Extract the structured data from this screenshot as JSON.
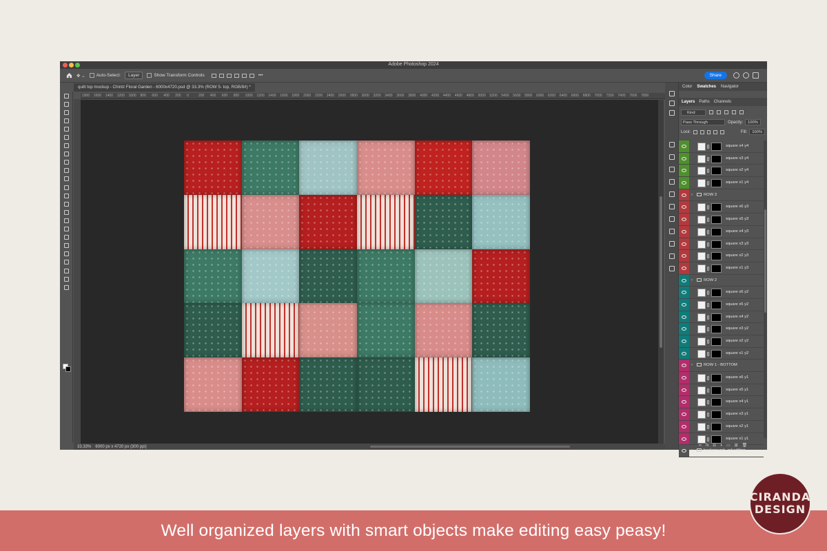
{
  "window": {
    "app_title": "Adobe Photoshop 2024",
    "document_tab": "quilt top mockup - Chintz Floral Garden - 6000x4720.psd @ 33.3% (ROW  5- top, RGB/8#) *"
  },
  "options_bar": {
    "auto_select_label": "Auto-Select:",
    "auto_select_value": "Layer",
    "show_transform_label": "Show Transform Controls",
    "more_label": "•••",
    "share_label": "Share"
  },
  "ruler_top": [
    "1900",
    "1600",
    "1400",
    "1200",
    "1000",
    "800",
    "600",
    "400",
    "200",
    "0",
    "200",
    "400",
    "600",
    "800",
    "1000",
    "1200",
    "1400",
    "1600",
    "1800",
    "2000",
    "2200",
    "2400",
    "2600",
    "2800",
    "3000",
    "3200",
    "3400",
    "3600",
    "3800",
    "4000",
    "4200",
    "4400",
    "4600",
    "4800",
    "5000",
    "5200",
    "5400",
    "5600",
    "5800",
    "6000",
    "6200",
    "6400",
    "6600",
    "6800",
    "7000",
    "7200",
    "7400",
    "7600",
    "7800"
  ],
  "status_bar": {
    "zoom": "33.33%",
    "doc_info": "6000 px x 4720 px (300 ppi)"
  },
  "quilt": {
    "rows": [
      [
        "#b8201f",
        "#3d7a65",
        "#9fc4c3",
        "#d98d8a",
        "#c0221f",
        "#d2868a"
      ],
      [
        "#f0e4dc",
        "#d88e8c",
        "#b51f1f",
        "#efe2da",
        "#2e5d4e",
        "#95c0c0"
      ],
      [
        "#3d7a65",
        "#a3c8c8",
        "#2e5d4e",
        "#3d7a65",
        "#9cc3bb",
        "#b51f1f"
      ],
      [
        "#2e5d4e",
        "#efe2da",
        "#d8908a",
        "#3d7a65",
        "#d88c8a",
        "#2e5d4e"
      ],
      [
        "#d98d8a",
        "#b51f1f",
        "#2e5d4e",
        "#2e5d4e",
        "#efe2da",
        "#8ebcbc"
      ]
    ]
  },
  "panel": {
    "top_tabs": [
      "Color",
      "Swatches",
      "Navigator"
    ],
    "layer_tabs": [
      "Layers",
      "Paths",
      "Channels"
    ],
    "kind_label": "Kind",
    "blend_mode": "Pass Through",
    "opacity_label": "Opacity:",
    "opacity_value": "100%",
    "lock_label": "Lock:",
    "fill_label": "Fill:",
    "fill_value": "100%",
    "layers": [
      {
        "type": "layer",
        "name": "square x4 y4",
        "color": "#4f8f2e"
      },
      {
        "type": "layer",
        "name": "square x3 y4",
        "color": "#4f8f2e"
      },
      {
        "type": "layer",
        "name": "square x2 y4",
        "color": "#4f8f2e"
      },
      {
        "type": "layer",
        "name": "square x1 y4",
        "color": "#4f8f2e"
      },
      {
        "type": "group",
        "name": "ROW 3",
        "color": "#b3393d"
      },
      {
        "type": "layer",
        "name": "square x6 y3",
        "color": "#b3393d"
      },
      {
        "type": "layer",
        "name": "square x5 y3",
        "color": "#b3393d"
      },
      {
        "type": "layer",
        "name": "square x4 y3",
        "color": "#b3393d"
      },
      {
        "type": "layer",
        "name": "square x3 y3",
        "color": "#b3393d"
      },
      {
        "type": "layer",
        "name": "square x2 y3",
        "color": "#b3393d"
      },
      {
        "type": "layer",
        "name": "square x1 y3",
        "color": "#b3393d"
      },
      {
        "type": "group",
        "name": "ROW 2",
        "color": "#0f7c7a"
      },
      {
        "type": "layer",
        "name": "square x6 y2",
        "color": "#0f7c7a"
      },
      {
        "type": "layer",
        "name": "square x5 y2",
        "color": "#0f7c7a"
      },
      {
        "type": "layer",
        "name": "square x4 y2",
        "color": "#0f7c7a"
      },
      {
        "type": "layer",
        "name": "square x3 y2",
        "color": "#0f7c7a"
      },
      {
        "type": "layer",
        "name": "square x2 y2",
        "color": "#0f7c7a"
      },
      {
        "type": "layer",
        "name": "square x1 y2",
        "color": "#0f7c7a"
      },
      {
        "type": "group",
        "name": "ROW 1 - BOTTOM",
        "color": "#b32d6b"
      },
      {
        "type": "layer",
        "name": "square x6 y1",
        "color": "#b32d6b"
      },
      {
        "type": "layer",
        "name": "square x5 y1",
        "color": "#b32d6b"
      },
      {
        "type": "layer",
        "name": "square x4 y1",
        "color": "#b32d6b"
      },
      {
        "type": "layer",
        "name": "square x3 y1",
        "color": "#b32d6b"
      },
      {
        "type": "layer",
        "name": "square x2 y1",
        "color": "#b32d6b"
      },
      {
        "type": "layer",
        "name": "square x1 y1",
        "color": "#b32d6b"
      },
      {
        "type": "group",
        "name": "background...nd editing",
        "color": "#535353"
      }
    ]
  },
  "banner": {
    "caption": "Well organized layers with smart objects make editing easy peasy!"
  },
  "logo": {
    "line1": "CIRANDA",
    "line2": "DESIGN"
  }
}
